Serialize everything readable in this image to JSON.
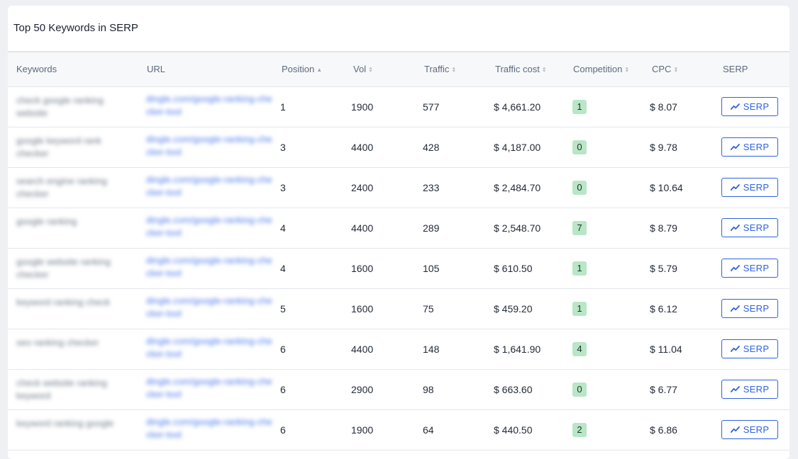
{
  "title": "Top 50 Keywords in SERP",
  "columns": {
    "keywords": "Keywords",
    "url": "URL",
    "position": "Position",
    "vol": "Vol",
    "traffic": "Traffic",
    "traffic_cost": "Traffic cost",
    "competition": "Competition",
    "cpc": "CPC",
    "serp": "SERP"
  },
  "sort_icons": {
    "position": "▲",
    "other": "⇕"
  },
  "serp_button_label": "SERP",
  "serp_icon": "trend-line-icon",
  "colors": {
    "accent": "#2f62e0",
    "competition_badge": "#b8e6c6"
  },
  "rows": [
    {
      "keyword": "check google ranking website",
      "url": "dingle.com/google-ranking-checker-tool",
      "position": "1",
      "vol": "1900",
      "traffic": "577",
      "traffic_cost": "$ 4,661.20",
      "competition": "1",
      "cpc": "$ 8.07"
    },
    {
      "keyword": "google keyword rank checker",
      "url": "dingle.com/google-ranking-checker-tool",
      "position": "3",
      "vol": "4400",
      "traffic": "428",
      "traffic_cost": "$ 4,187.00",
      "competition": "0",
      "cpc": "$ 9.78"
    },
    {
      "keyword": "search engine ranking checker",
      "url": "dingle.com/google-ranking-checker-tool",
      "position": "3",
      "vol": "2400",
      "traffic": "233",
      "traffic_cost": "$ 2,484.70",
      "competition": "0",
      "cpc": "$ 10.64"
    },
    {
      "keyword": "google ranking",
      "url": "dingle.com/google-ranking-checker-tool",
      "position": "4",
      "vol": "4400",
      "traffic": "289",
      "traffic_cost": "$ 2,548.70",
      "competition": "7",
      "cpc": "$ 8.79"
    },
    {
      "keyword": "google website ranking checker",
      "url": "dingle.com/google-ranking-checker-tool",
      "position": "4",
      "vol": "1600",
      "traffic": "105",
      "traffic_cost": "$ 610.50",
      "competition": "1",
      "cpc": "$ 5.79"
    },
    {
      "keyword": "keyword ranking check",
      "url": "dingle.com/google-ranking-checker-tool",
      "position": "5",
      "vol": "1600",
      "traffic": "75",
      "traffic_cost": "$ 459.20",
      "competition": "1",
      "cpc": "$ 6.12"
    },
    {
      "keyword": "seo ranking checker",
      "url": "dingle.com/google-ranking-checker-tool",
      "position": "6",
      "vol": "4400",
      "traffic": "148",
      "traffic_cost": "$ 1,641.90",
      "competition": "4",
      "cpc": "$ 11.04"
    },
    {
      "keyword": "check website ranking keyword",
      "url": "dingle.com/google-ranking-checker-tool",
      "position": "6",
      "vol": "2900",
      "traffic": "98",
      "traffic_cost": "$ 663.60",
      "competition": "0",
      "cpc": "$ 6.77"
    },
    {
      "keyword": "keyword ranking google",
      "url": "dingle.com/google-ranking-checker-tool",
      "position": "6",
      "vol": "1900",
      "traffic": "64",
      "traffic_cost": "$ 440.50",
      "competition": "2",
      "cpc": "$ 6.86"
    }
  ]
}
